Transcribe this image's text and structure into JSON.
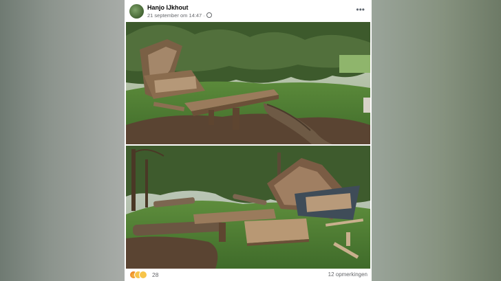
{
  "post": {
    "author": "Hanjo IJkhout",
    "timestamp": "21 september om 14:47 ·",
    "privacy_icon": "globe-icon",
    "menu_icon": "more-options-icon"
  },
  "footer": {
    "reaction_icons": [
      "angry-reaction-icon",
      "sad-reaction-icon",
      "wow-reaction-icon"
    ],
    "reaction_count": "28",
    "comments": "12 opmerkingen"
  }
}
